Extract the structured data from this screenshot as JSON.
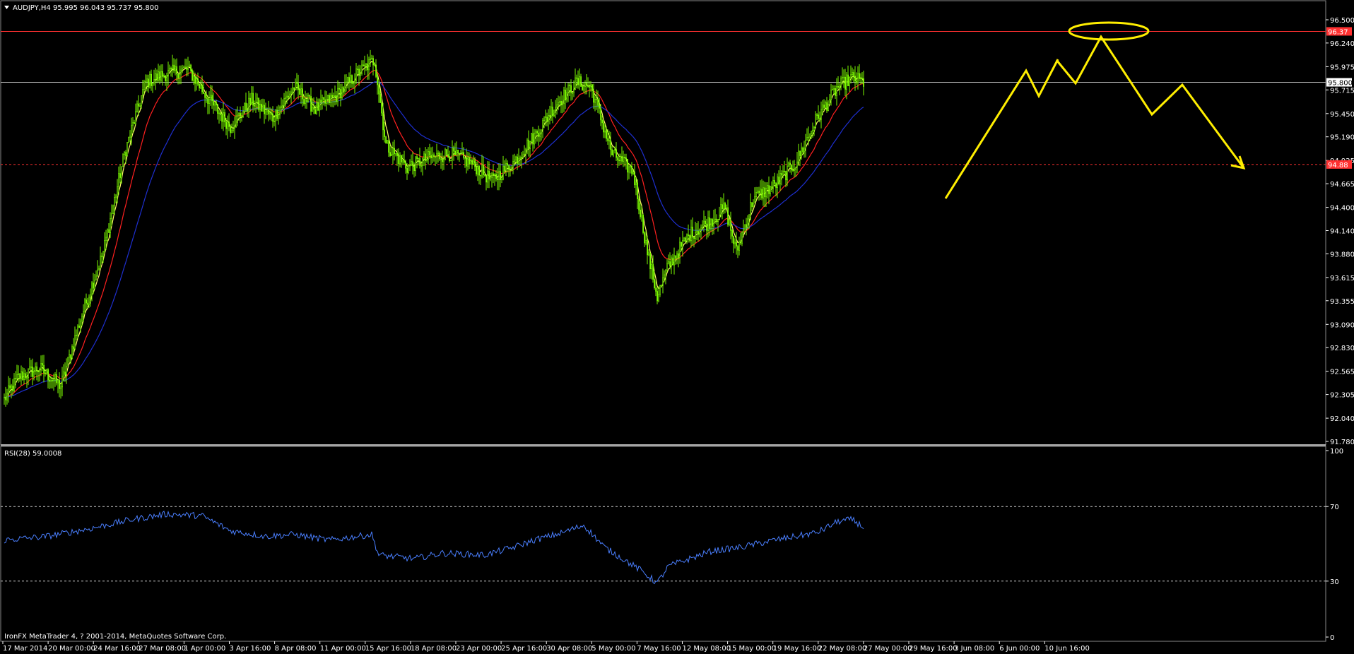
{
  "header": {
    "symbol_line": "AUDJPY,H4  95.995 96.043 95.737 95.800"
  },
  "rsi_header": "RSI(28) 59.0008",
  "copyright": "IronFX MetaTrader 4, ? 2001-2014, MetaQuotes Software Corp.",
  "colors": {
    "background": "#000000",
    "candles": "#7CFC00",
    "fast_ma": "#FFFF66",
    "mid_ma": "#FF2020",
    "slow_ma": "#1E2FD0",
    "rsi_line": "#4A7FFF",
    "drawing": "#FFEE00",
    "resistance": "#FF3030",
    "support": "#FF3030",
    "current_price": "#C0C0C0"
  },
  "chart_data": [
    {
      "type": "candlestick",
      "symbol": "AUDJPY",
      "timeframe": "H4",
      "ylim": [
        91.78,
        96.5
      ],
      "y_ticks": [
        "96.500",
        "96.240",
        "95.975",
        "95.715",
        "95.450",
        "95.190",
        "94.925",
        "94.665",
        "94.400",
        "94.140",
        "93.880",
        "93.615",
        "93.355",
        "93.090",
        "92.830",
        "92.565",
        "92.305",
        "92.040",
        "91.780"
      ],
      "x_ticks": [
        "17 Mar 2014",
        "20 Mar 00:00",
        "24 Mar 16:00",
        "27 Mar 08:00",
        "1 Apr 00:00",
        "3 Apr 16:00",
        "8 Apr 08:00",
        "11 Apr 00:00",
        "15 Apr 16:00",
        "18 Apr 08:00",
        "23 Apr 00:00",
        "25 Apr 16:00",
        "30 Apr 08:00",
        "5 May 00:00",
        "7 May 16:00",
        "12 May 08:00",
        "15 May 00:00",
        "19 May 16:00",
        "22 May 08:00",
        "27 May 00:00",
        "29 May 16:00",
        "3 Jun 08:00",
        "6 Jun 00:00",
        "10 Jun 16:00"
      ],
      "price_keypoints": [
        [
          0,
          92.25
        ],
        [
          10,
          92.5
        ],
        [
          25,
          92.6
        ],
        [
          40,
          92.4
        ],
        [
          55,
          93.2
        ],
        [
          70,
          93.9
        ],
        [
          85,
          95.0
        ],
        [
          100,
          95.8
        ],
        [
          115,
          95.9
        ],
        [
          130,
          95.95
        ],
        [
          145,
          95.6
        ],
        [
          160,
          95.3
        ],
        [
          175,
          95.6
        ],
        [
          190,
          95.4
        ],
        [
          205,
          95.75
        ],
        [
          220,
          95.5
        ],
        [
          235,
          95.65
        ],
        [
          250,
          95.9
        ],
        [
          262,
          96.05
        ],
        [
          270,
          95.1
        ],
        [
          285,
          94.85
        ],
        [
          300,
          94.95
        ],
        [
          315,
          95.0
        ],
        [
          330,
          94.9
        ],
        [
          345,
          94.7
        ],
        [
          360,
          94.9
        ],
        [
          375,
          95.2
        ],
        [
          390,
          95.55
        ],
        [
          405,
          95.8
        ],
        [
          415,
          95.75
        ],
        [
          430,
          95.0
        ],
        [
          445,
          94.8
        ],
        [
          455,
          93.9
        ],
        [
          462,
          93.4
        ],
        [
          470,
          93.75
        ],
        [
          485,
          94.1
        ],
        [
          500,
          94.25
        ],
        [
          510,
          94.4
        ],
        [
          518,
          93.9
        ],
        [
          530,
          94.5
        ],
        [
          545,
          94.65
        ],
        [
          560,
          94.9
        ],
        [
          575,
          95.4
        ],
        [
          590,
          95.75
        ],
        [
          600,
          95.85
        ],
        [
          608,
          95.8
        ]
      ],
      "total_bars": 609,
      "current_price": 95.8,
      "resistance_level": 96.37,
      "support_level": 94.88,
      "current_price_label": "95.800",
      "resistance_label": "96.37",
      "support_label": "94.88",
      "projection": [
        [
          1495,
          85
        ],
        [
          1522,
          118
        ],
        [
          1558,
          52
        ],
        [
          1630,
          162
        ],
        [
          1673,
          120
        ],
        [
          1760,
          238
        ]
      ],
      "projection_entry": [
        [
          1338,
          281
        ],
        [
          1452,
          100
        ],
        [
          1470,
          136
        ],
        [
          1497,
          84
        ]
      ],
      "projection_ellipse": {
        "cx": 1569,
        "cy": 44,
        "rx": 56,
        "ry": 12
      }
    },
    {
      "type": "line",
      "indicator": "RSI",
      "period": 28,
      "value": 59.0008,
      "ylim": [
        0,
        100
      ],
      "levels": [
        70,
        30
      ],
      "y_ticks": [
        "100",
        "70",
        "30",
        "0"
      ],
      "rsi_keypoints": [
        [
          0,
          52
        ],
        [
          30,
          54
        ],
        [
          60,
          58
        ],
        [
          90,
          63
        ],
        [
          115,
          66
        ],
        [
          140,
          65
        ],
        [
          160,
          57
        ],
        [
          185,
          54
        ],
        [
          205,
          55
        ],
        [
          230,
          52
        ],
        [
          260,
          55
        ],
        [
          265,
          44
        ],
        [
          290,
          42
        ],
        [
          310,
          45
        ],
        [
          340,
          44
        ],
        [
          360,
          48
        ],
        [
          375,
          52
        ],
        [
          395,
          56
        ],
        [
          410,
          60
        ],
        [
          425,
          48
        ],
        [
          450,
          36
        ],
        [
          462,
          29
        ],
        [
          470,
          38
        ],
        [
          500,
          46
        ],
        [
          520,
          48
        ],
        [
          545,
          52
        ],
        [
          575,
          56
        ],
        [
          590,
          62
        ],
        [
          600,
          63
        ],
        [
          608,
          59
        ]
      ]
    }
  ]
}
